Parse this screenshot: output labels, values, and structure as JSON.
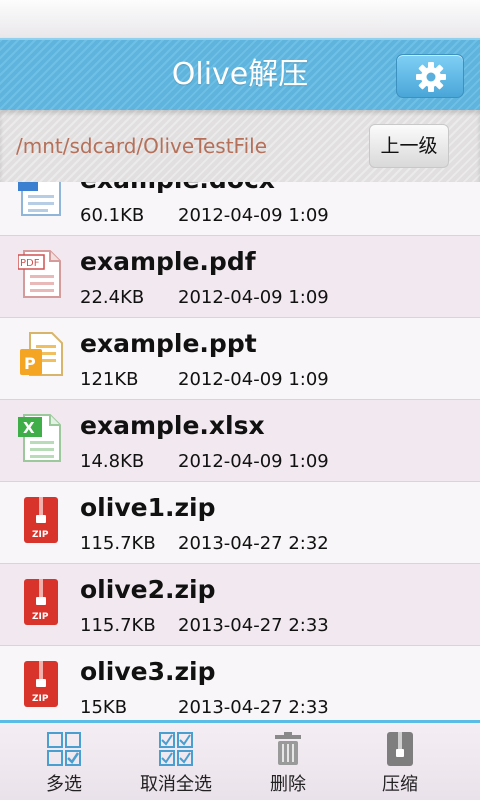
{
  "app": {
    "title": "Olive解压"
  },
  "toolbar": {
    "settings_icon": "gear-icon",
    "up_label": "上一级"
  },
  "path": {
    "current": "/mnt/sdcard/OliveTestFile"
  },
  "files": [
    {
      "name": "example.docx",
      "size": "60.1KB",
      "date": "2012-04-09 1:09",
      "icon": "docx-file-icon"
    },
    {
      "name": "example.pdf",
      "size": "22.4KB",
      "date": "2012-04-09 1:09",
      "icon": "pdf-file-icon"
    },
    {
      "name": "example.ppt",
      "size": "121KB",
      "date": "2012-04-09 1:09",
      "icon": "ppt-file-icon"
    },
    {
      "name": "example.xlsx",
      "size": "14.8KB",
      "date": "2012-04-09 1:09",
      "icon": "xlsx-file-icon"
    },
    {
      "name": "olive1.zip",
      "size": "115.7KB",
      "date": "2013-04-27 2:32",
      "icon": "zip-file-icon"
    },
    {
      "name": "olive2.zip",
      "size": "115.7KB",
      "date": "2013-04-27 2:33",
      "icon": "zip-file-icon"
    },
    {
      "name": "olive3.zip",
      "size": "15KB",
      "date": "2013-04-27 2:33",
      "icon": "zip-file-icon"
    }
  ],
  "bottom_bar": {
    "multi_select": "多选",
    "deselect_all": "取消全选",
    "delete": "删除",
    "compress": "压缩"
  },
  "colors": {
    "accent": "#5fb4dd",
    "path_text": "#b5705a",
    "zip_red": "#d9342b"
  }
}
